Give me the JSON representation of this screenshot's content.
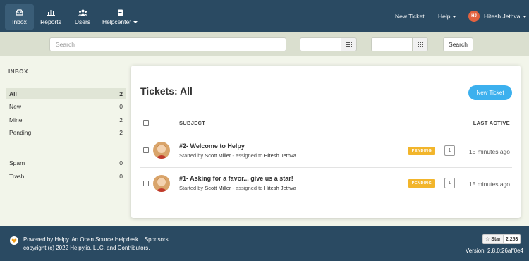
{
  "nav": {
    "items": [
      {
        "label": "Inbox",
        "icon": "inbox-icon"
      },
      {
        "label": "Reports",
        "icon": "chart-icon"
      },
      {
        "label": "Users",
        "icon": "users-icon"
      },
      {
        "label": "Helpcenter",
        "icon": "book-icon"
      }
    ],
    "new_ticket": "New Ticket",
    "help": "Help",
    "user_initials": "HJ",
    "user_name": "Hitesh Jethva"
  },
  "search": {
    "placeholder": "Search",
    "button": "Search"
  },
  "sidebar": {
    "title": "INBOX",
    "items": [
      {
        "label": "All",
        "count": "2"
      },
      {
        "label": "New",
        "count": "0"
      },
      {
        "label": "Mine",
        "count": "2"
      },
      {
        "label": "Pending",
        "count": "2"
      },
      {
        "label": "Spam",
        "count": "0"
      },
      {
        "label": "Trash",
        "count": "0"
      }
    ]
  },
  "main": {
    "title": "Tickets: All",
    "new_ticket_button": "New Ticket",
    "columns": {
      "subject": "SUBJECT",
      "last_active": "LAST ACTIVE"
    },
    "tickets": [
      {
        "subject": "#2- Welcome to Helpy",
        "started_prefix": "Started by",
        "author": "Scott Miller",
        "assigned_prefix": "- assigned to",
        "assignee": "Hitesh Jethva",
        "status": "PENDING",
        "replies": "1",
        "last_active": "15 minutes ago"
      },
      {
        "subject": "#1- Asking for a favor... give us a star!",
        "started_prefix": "Started by",
        "author": "Scott Miller",
        "assigned_prefix": "- assigned to",
        "assignee": "Hitesh Jethva",
        "status": "PENDING",
        "replies": "1",
        "last_active": "15 minutes ago"
      }
    ]
  },
  "footer": {
    "line1": "Powered by Helpy. An Open Source Helpdesk. | Sponsors",
    "line2": "copyright (c) 2022 Helpy.io, LLC, and Contributors.",
    "star_label": "Star",
    "star_count": "2,253",
    "version": "Version: 2.8.0:26aff0e4"
  },
  "colors": {
    "nav_bg": "#2a4a62",
    "accent": "#3cb0ee",
    "pending": "#f2b52b",
    "avatar": "#e2623f"
  }
}
